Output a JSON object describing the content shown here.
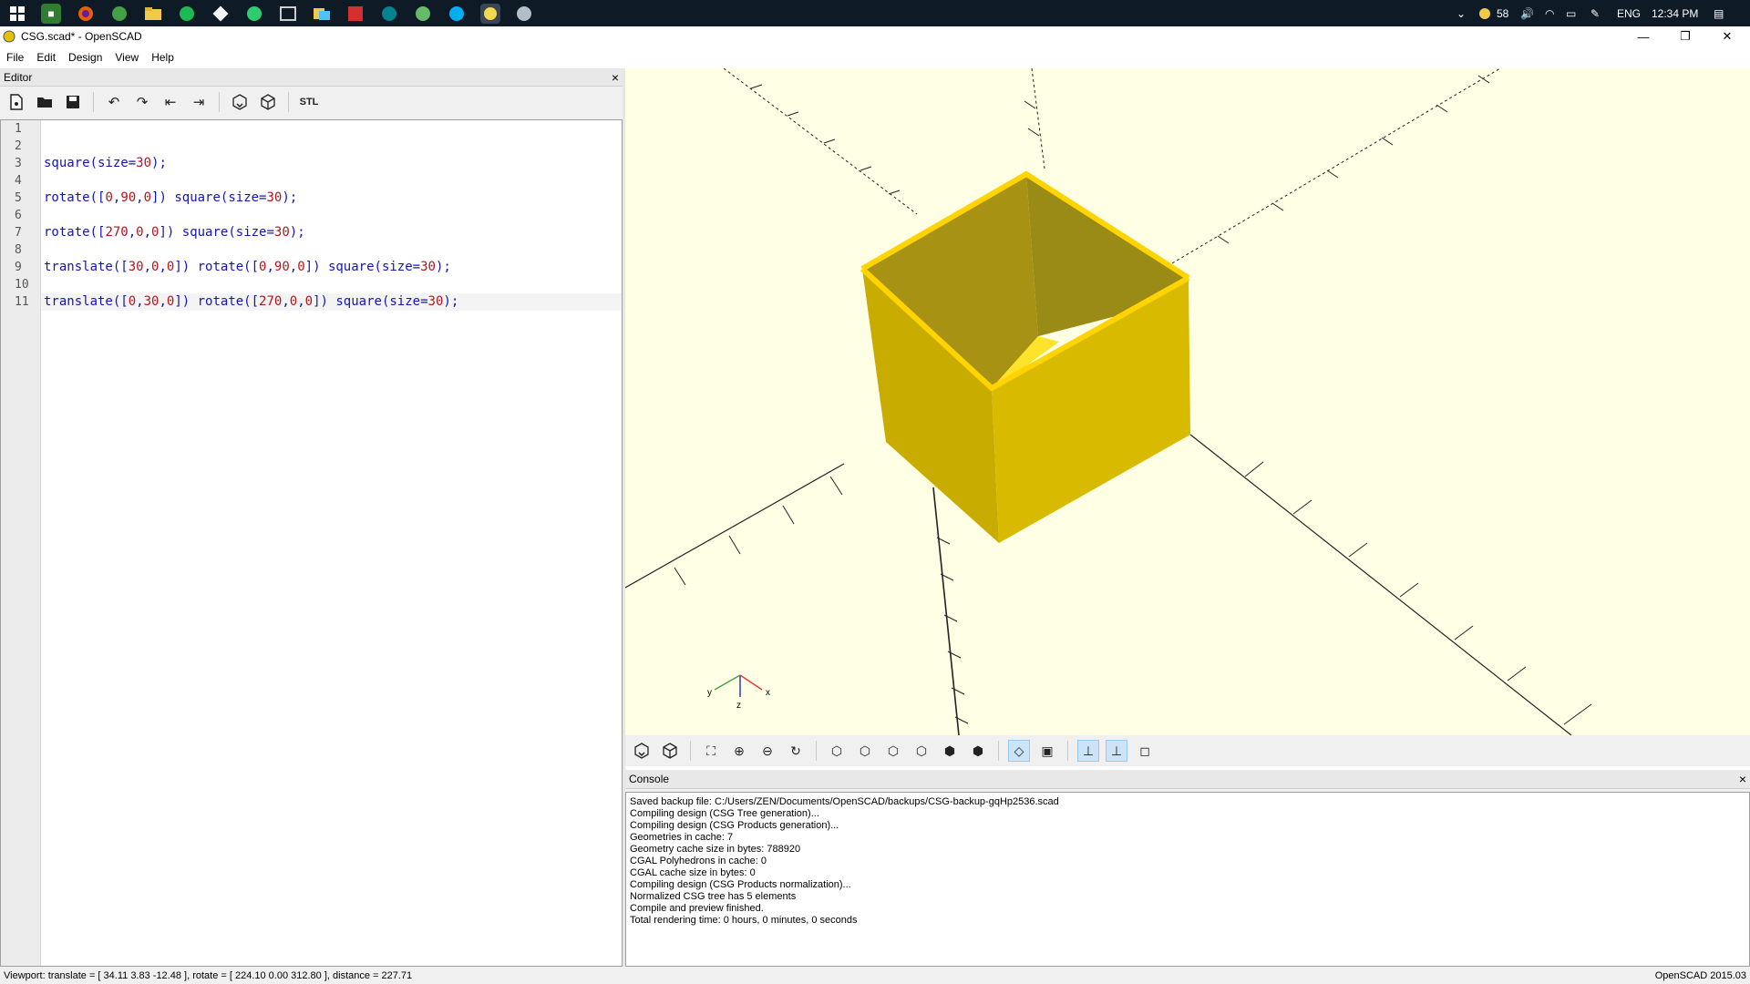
{
  "taskbar": {
    "apps": [
      "start",
      "notepad-green",
      "firefox",
      "app-green",
      "folder",
      "spotify",
      "git",
      "app-green-arrow",
      "app-window",
      "app-yellow",
      "acrobat",
      "app-infinity",
      "app-globe",
      "skype",
      "openscad",
      "app-gray"
    ],
    "tray": {
      "weather": "58",
      "language": "ENG",
      "time": "12:34 PM"
    }
  },
  "window": {
    "title": "CSG.scad* - OpenSCAD"
  },
  "menu": {
    "items": [
      "File",
      "Edit",
      "Design",
      "View",
      "Help"
    ]
  },
  "editor": {
    "header": "Editor",
    "close": "×",
    "toolbar": [
      "new-icon",
      "open-icon",
      "save-icon",
      "undo-icon",
      "redo-icon",
      "unindent-icon",
      "indent-icon",
      "preview-icon",
      "render-icon",
      "stl-icon"
    ],
    "stl_label": "STL",
    "lines": [
      {
        "n": "1",
        "code": ""
      },
      {
        "n": "2",
        "code": ""
      },
      {
        "n": "3",
        "parts": [
          {
            "t": "square(size=",
            "c": "#1414b4"
          },
          {
            "t": "30",
            "c": "#b4141e"
          },
          {
            "t": ");",
            "c": "#1414b4"
          }
        ]
      },
      {
        "n": "4",
        "code": ""
      },
      {
        "n": "5",
        "parts": [
          {
            "t": "rotate([",
            "c": "#1414b4"
          },
          {
            "t": "0",
            "c": "#b4141e"
          },
          {
            "t": ",",
            "c": "#1414b4"
          },
          {
            "t": "90",
            "c": "#b4141e"
          },
          {
            "t": ",",
            "c": "#1414b4"
          },
          {
            "t": "0",
            "c": "#b4141e"
          },
          {
            "t": "]) square(size=",
            "c": "#1414b4"
          },
          {
            "t": "30",
            "c": "#b4141e"
          },
          {
            "t": ");",
            "c": "#1414b4"
          }
        ]
      },
      {
        "n": "6",
        "code": ""
      },
      {
        "n": "7",
        "parts": [
          {
            "t": "rotate([",
            "c": "#1414b4"
          },
          {
            "t": "270",
            "c": "#b4141e"
          },
          {
            "t": ",",
            "c": "#1414b4"
          },
          {
            "t": "0",
            "c": "#b4141e"
          },
          {
            "t": ",",
            "c": "#1414b4"
          },
          {
            "t": "0",
            "c": "#b4141e"
          },
          {
            "t": "]) square(size=",
            "c": "#1414b4"
          },
          {
            "t": "30",
            "c": "#b4141e"
          },
          {
            "t": ");",
            "c": "#1414b4"
          }
        ]
      },
      {
        "n": "8",
        "code": ""
      },
      {
        "n": "9",
        "parts": [
          {
            "t": "translate([",
            "c": "#1414b4"
          },
          {
            "t": "30",
            "c": "#b4141e"
          },
          {
            "t": ",",
            "c": "#1414b4"
          },
          {
            "t": "0",
            "c": "#b4141e"
          },
          {
            "t": ",",
            "c": "#1414b4"
          },
          {
            "t": "0",
            "c": "#b4141e"
          },
          {
            "t": "]) rotate([",
            "c": "#1414b4"
          },
          {
            "t": "0",
            "c": "#b4141e"
          },
          {
            "t": ",",
            "c": "#1414b4"
          },
          {
            "t": "90",
            "c": "#b4141e"
          },
          {
            "t": ",",
            "c": "#1414b4"
          },
          {
            "t": "0",
            "c": "#b4141e"
          },
          {
            "t": "]) square(size=",
            "c": "#1414b4"
          },
          {
            "t": "30",
            "c": "#b4141e"
          },
          {
            "t": ");",
            "c": "#1414b4"
          }
        ]
      },
      {
        "n": "10",
        "code": ""
      },
      {
        "n": "11",
        "current": true,
        "parts": [
          {
            "t": "translate([",
            "c": "#1414b4"
          },
          {
            "t": "0",
            "c": "#b4141e"
          },
          {
            "t": ",",
            "c": "#1414b4"
          },
          {
            "t": "30",
            "c": "#b4141e"
          },
          {
            "t": ",",
            "c": "#1414b4"
          },
          {
            "t": "0",
            "c": "#b4141e"
          },
          {
            "t": "]) rotate([",
            "c": "#1414b4"
          },
          {
            "t": "270",
            "c": "#b4141e"
          },
          {
            "t": ",",
            "c": "#1414b4"
          },
          {
            "t": "0",
            "c": "#b4141e"
          },
          {
            "t": ",",
            "c": "#1414b4"
          },
          {
            "t": "0",
            "c": "#b4141e"
          },
          {
            "t": "]) square(size=",
            "c": "#1414b4"
          },
          {
            "t": "30",
            "c": "#b4141e"
          },
          {
            "t": ");",
            "c": "#1414b4"
          }
        ]
      }
    ]
  },
  "viewport": {
    "background": "#ffffe5",
    "model_color": "#e3c000",
    "axis_labels": {
      "x": "x",
      "y": "y",
      "z": "z"
    }
  },
  "view_toolbar": [
    "preview-icon",
    "render-icon",
    "view-all-icon",
    "zoom-in-icon",
    "zoom-out-icon",
    "reset-view-icon",
    "view-right-icon",
    "view-top-icon",
    "view-bottom-icon",
    "view-left-icon",
    "view-front-icon",
    "view-back-icon",
    "perspective-icon",
    "orthogonal-icon",
    "show-axes-icon",
    "show-scale-icon",
    "show-edges-icon"
  ],
  "console": {
    "header": "Console",
    "close": "×",
    "lines": [
      "Saved backup file: C:/Users/ZEN/Documents/OpenSCAD/backups/CSG-backup-gqHp2536.scad",
      "Compiling design (CSG Tree generation)...",
      "Compiling design (CSG Products generation)...",
      "Geometries in cache: 7",
      "Geometry cache size in bytes: 788920",
      "CGAL Polyhedrons in cache: 0",
      "CGAL cache size in bytes: 0",
      "Compiling design (CSG Products normalization)...",
      "Normalized CSG tree has 5 elements",
      "Compile and preview finished.",
      "Total rendering time: 0 hours, 0 minutes, 0 seconds"
    ]
  },
  "status": {
    "viewport": "Viewport: translate = [ 34.11 3.83 -12.48 ], rotate = [ 224.10 0.00 312.80 ], distance = 227.71",
    "version": "OpenSCAD 2015.03"
  }
}
